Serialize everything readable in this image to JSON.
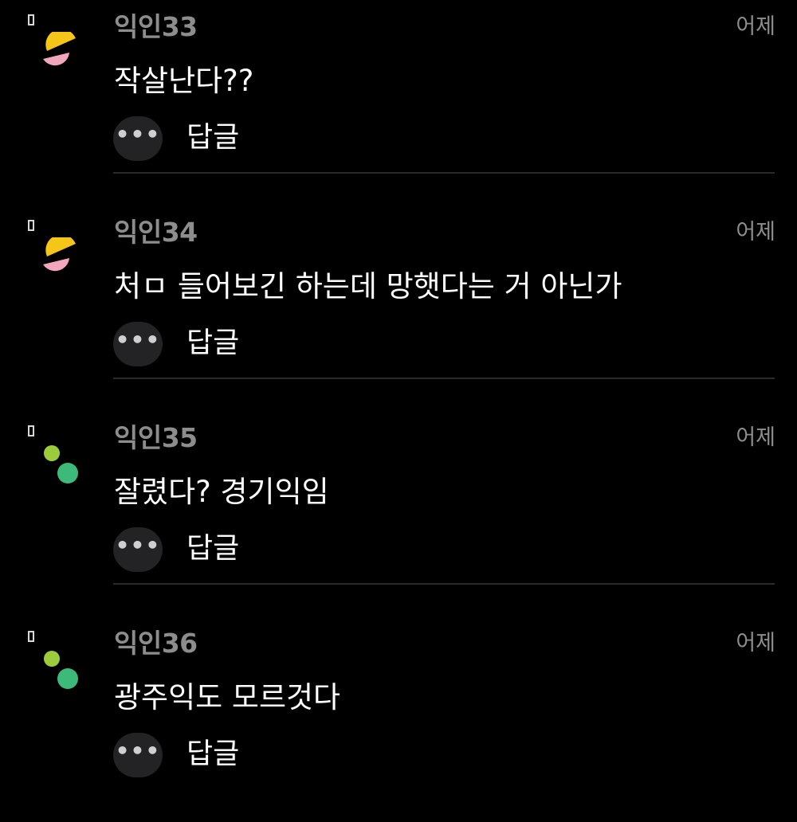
{
  "comments": [
    {
      "author": "익인33",
      "time": "어제",
      "text": "작살난다??",
      "reply_label": "답글",
      "avatar_style": "half-circles",
      "avatar_colors": [
        "#f5c518",
        "#f2a7bd"
      ]
    },
    {
      "author": "익인34",
      "time": "어제",
      "text": "처ㅁ 들어보긴 하는데 망햇다는 거 아닌가",
      "reply_label": "답글",
      "avatar_style": "half-circles",
      "avatar_colors": [
        "#f5c518",
        "#f2a7bd"
      ]
    },
    {
      "author": "익인35",
      "time": "어제",
      "text": "잘렸다? 경기익임",
      "reply_label": "답글",
      "avatar_style": "two-dots",
      "avatar_colors": [
        "#9ccc3c",
        "#3dba7a"
      ]
    },
    {
      "author": "익인36",
      "time": "어제",
      "text": "광주익도 모르것다",
      "reply_label": "답글",
      "avatar_style": "two-dots",
      "avatar_colors": [
        "#9ccc3c",
        "#3dba7a"
      ]
    }
  ],
  "more_button_glyph": "•••"
}
